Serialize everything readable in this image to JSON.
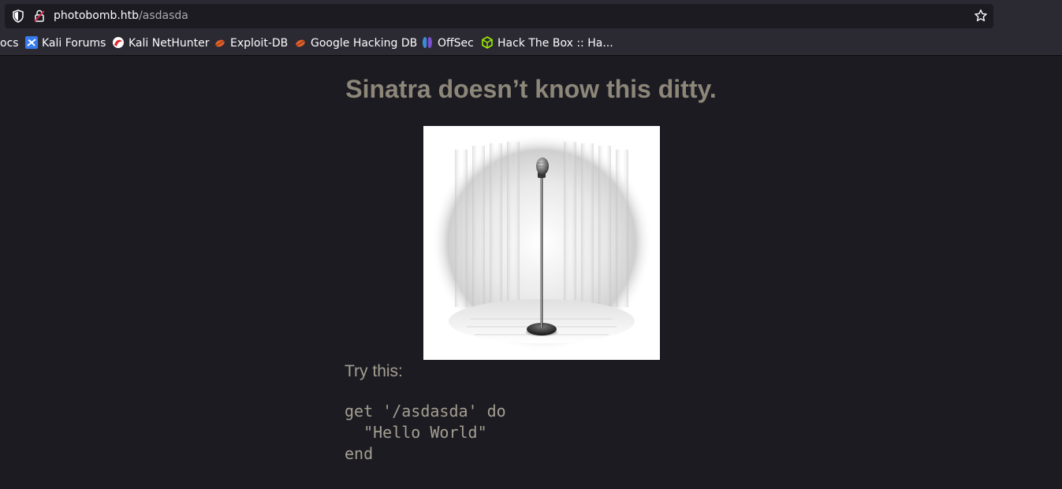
{
  "browser": {
    "url_host": "photobomb.htb",
    "url_path": "/asdasda",
    "bookmarks": [
      {
        "label": "ocs",
        "icon": "partial-bookmark-icon"
      },
      {
        "label": "Kali Forums",
        "icon": "kali-forums-icon"
      },
      {
        "label": "Kali NetHunter",
        "icon": "kali-nethunter-icon"
      },
      {
        "label": "Exploit-DB",
        "icon": "exploit-db-icon"
      },
      {
        "label": "Google Hacking DB",
        "icon": "google-hacking-db-icon"
      },
      {
        "label": "OffSec",
        "icon": "offsec-icon"
      },
      {
        "label": "Hack The Box :: Ha...",
        "icon": "hack-the-box-icon"
      }
    ]
  },
  "page": {
    "heading": "Sinatra doesn’t know this ditty.",
    "image": "microphone-on-stage-image",
    "try_label": "Try this:",
    "code": "get '/asdasda' do\n  \"Hello World\"\nend"
  },
  "colors": {
    "background": "#1c1b22",
    "heading": "#8d8779",
    "text": "#a39f91"
  }
}
